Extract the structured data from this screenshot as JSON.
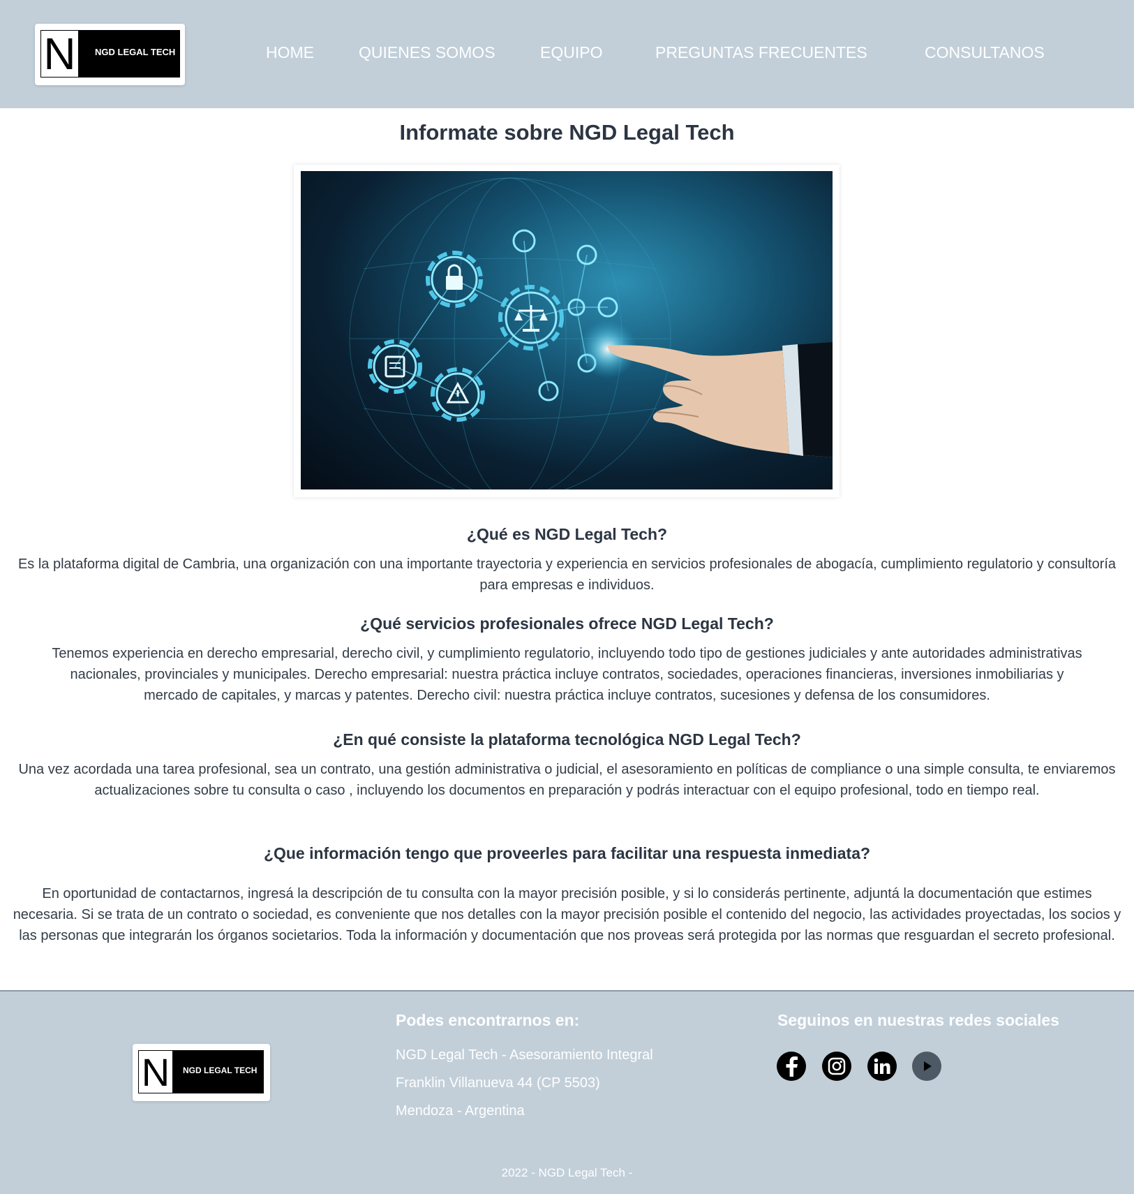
{
  "brand": {
    "logo_letter": "N",
    "logo_text": "NGD LEGAL TECH"
  },
  "nav": {
    "items": [
      "HOME",
      "QUIENES SOMOS",
      "EQUIPO",
      "PREGUNTAS FRECUENTES",
      "CONSULTANOS"
    ]
  },
  "main": {
    "title": "Informate sobre NGD Legal Tech",
    "hero_image_icon": "legal-tech-network-hand-icon",
    "faq": [
      {
        "question": "¿Qué es NGD Legal Tech?",
        "answer": "Es la plataforma digital de Cambria, una organización con una importante trayectoria y experiencia en servicios profesionales de abogacía, cumplimiento regulatorio y consultoría para empresas e individuos."
      },
      {
        "question": "¿Qué servicios profesionales ofrece NGD Legal Tech?",
        "answer": "Tenemos experiencia en derecho empresarial, derecho civil, y cumplimiento regulatorio, incluyendo todo tipo de gestiones judiciales y ante autoridades administrativas nacionales, provinciales y municipales. Derecho empresarial: nuestra práctica incluye contratos, sociedades, operaciones financieras, inversiones inmobiliarias y mercado de capitales, y marcas y patentes. Derecho civil: nuestra práctica incluye contratos, sucesiones y defensa de los consumidores."
      },
      {
        "question": "¿En qué consiste la plataforma tecnológica NGD Legal Tech?",
        "answer": "Una vez acordada una tarea profesional, sea un contrato, una gestión administrativa o judicial, el asesoramiento en políticas de compliance o una simple consulta, te enviaremos actualizaciones sobre tu consulta o caso , incluyendo los documentos en preparación y podrás interactuar con el equipo profesional, todo en tiempo real."
      },
      {
        "question": "¿Que información tengo que proveerles para facilitar una respuesta inmediata?",
        "answer": "En oportunidad de contactarnos, ingresá la descripción de tu consulta con la mayor precisión posible, y si lo considerás pertinente, adjuntá la documentación que estimes necesaria. Si se trata de un contrato o sociedad, es conveniente que nos detalles con la mayor precisión posible el contenido del negocio, las actividades proyectadas, los socios y las personas que integrarán los órganos societarios. Toda la información y documentación que nos proveas será protegida por las normas que resguardan el secreto profesional."
      }
    ]
  },
  "footer": {
    "location_heading": "Podes encontrarnos en:",
    "location_lines": [
      "NGD Legal Tech - Asesoramiento Integral",
      "Franklin Villanueva 44 (CP 5503)",
      "Mendoza - Argentina"
    ],
    "social_heading": "Seguinos en nuestras redes sociales",
    "social_icons": [
      "facebook-icon",
      "instagram-icon",
      "linkedin-icon",
      "youtube-play-icon"
    ],
    "copyright": "2022 - NGD Legal Tech -"
  },
  "colors": {
    "header_bg": "#c2cfd9",
    "footer_bg": "#c2cfd9",
    "title_text": "#2c3542",
    "body_text": "#333c47",
    "nav_text": "#ffffff"
  }
}
